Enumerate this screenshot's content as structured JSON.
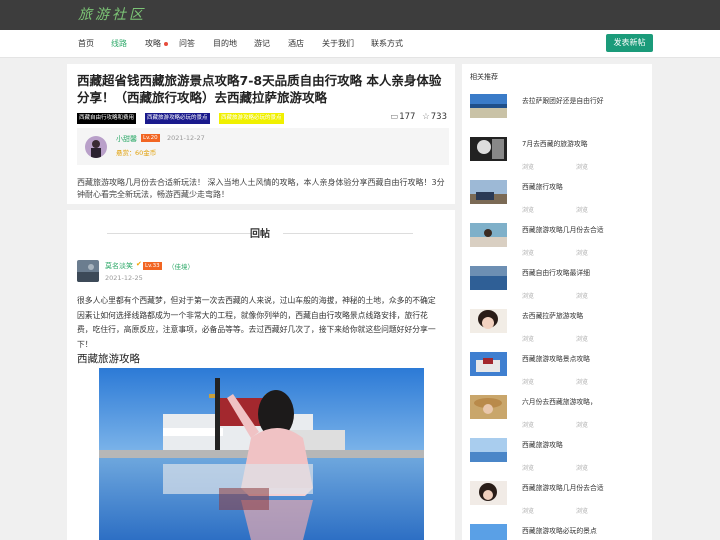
{
  "site": {
    "logo": "旅游社区"
  },
  "nav": {
    "items": [
      {
        "label": "首页"
      },
      {
        "label": "线路"
      },
      {
        "label": "攻略"
      },
      {
        "label": "问答"
      },
      {
        "label": "目的地"
      },
      {
        "label": "游记"
      },
      {
        "label": "酒店"
      },
      {
        "label": "关于我们"
      },
      {
        "label": "联系方式"
      }
    ],
    "post_button": "发表新帖",
    "colors": {
      "active": "#2faa6a",
      "hot_dot": "#e74c3c",
      "post_button": "#1b9b7a"
    }
  },
  "post": {
    "title": "西藏超省钱西藏旅游景点攻略7-8天品质自由行攻略 本人亲身体验分享！（西藏旅行攻略）去西藏拉萨旅游攻略",
    "tags": [
      "西藏自由行攻略和费用",
      "西藏旅游攻略必玩的景点",
      "西藏旅游攻略必玩的景点"
    ],
    "comment_count": "177",
    "favorite_count": "733",
    "author": {
      "name": "小甜馨",
      "level": "Lv.20",
      "date": "2021-12-27",
      "coin_label": "悬赏：",
      "coin_value": "60金币"
    },
    "excerpt": "西藏旅游攻略几月份去合适新玩法！ 深入当地人土风情的攻略，本人亲身体验分享西藏自由行攻略！3分钟耐心看完全新玩法，畅游西藏少走弯路！"
  },
  "reply": {
    "header": "回帖",
    "author": {
      "name": "莫名淡笑",
      "level": "Lv.33",
      "signature": "（佳境）",
      "date": "2021-12-25"
    },
    "body": "很多人心里都有个西藏梦，但对于第一次去西藏的人来说，过山车般的海拔，神秘的土地，众多的不确定因素让如何选择线路都成为一个非常大的工程，就像你列举的，西藏自由行攻略景点线路安排，旅行花费，吃住行，高原反应，注意事项，必备品等等。去过西藏好几次了，接下来给你就这些问题好好分享一下！",
    "section_title": "西藏旅游攻略"
  },
  "sidebar": {
    "title": "相关推荐",
    "meta_labels": {
      "views": "浏览",
      "reads": "浏览"
    },
    "items": [
      {
        "title": "去拉萨跟团好还是自由行好",
        "thumb": "lake"
      },
      {
        "title": "7月去西藏的旅游攻略",
        "thumb": "bw"
      },
      {
        "title": "西藏旅行攻略",
        "thumb": "car"
      },
      {
        "title": "西藏旅游攻略几月份去合适",
        "thumb": "girl"
      },
      {
        "title": "西藏自由行攻略最详细",
        "thumb": "sea"
      },
      {
        "title": "去西藏拉萨旅游攻略",
        "thumb": "face"
      },
      {
        "title": "西藏旅游攻略景点攻略",
        "thumb": "potala"
      },
      {
        "title": "六月份去西藏旅游攻略，",
        "thumb": "hat"
      },
      {
        "title": "西藏旅游攻略",
        "thumb": "blue"
      },
      {
        "title": "西藏旅游攻略几月份去合适",
        "thumb": "girl2"
      },
      {
        "title": "西藏旅游攻略必玩的景点",
        "thumb": "sky"
      }
    ]
  }
}
